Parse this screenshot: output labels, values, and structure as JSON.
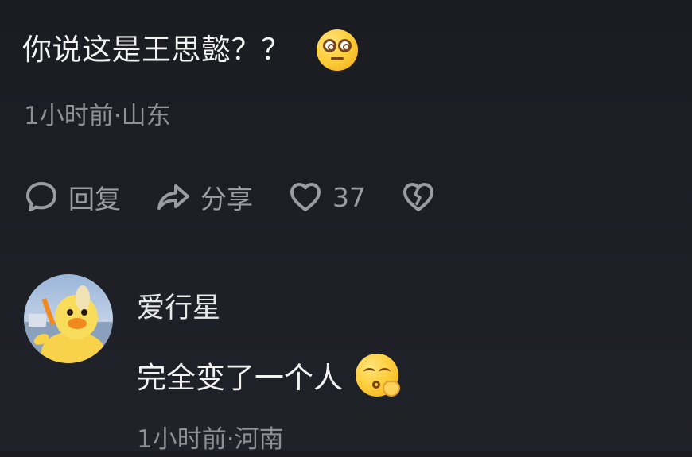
{
  "comment": {
    "text": "你说这是王思懿？？",
    "emoji": "dizzy-face-emoji",
    "meta": "1小时前·山东"
  },
  "actions": {
    "reply_label": "回复",
    "share_label": "分享",
    "like_count": "37"
  },
  "reply": {
    "username": "爱行星",
    "text": "完全变了一个人",
    "emoji": "shushing-face-emoji",
    "meta": "1小时前·河南"
  },
  "colors": {
    "background": "#1d1f26",
    "text_primary": "#f2f2f2",
    "text_secondary": "#8e9096",
    "emoji_yellow": "#ffcf3d"
  }
}
